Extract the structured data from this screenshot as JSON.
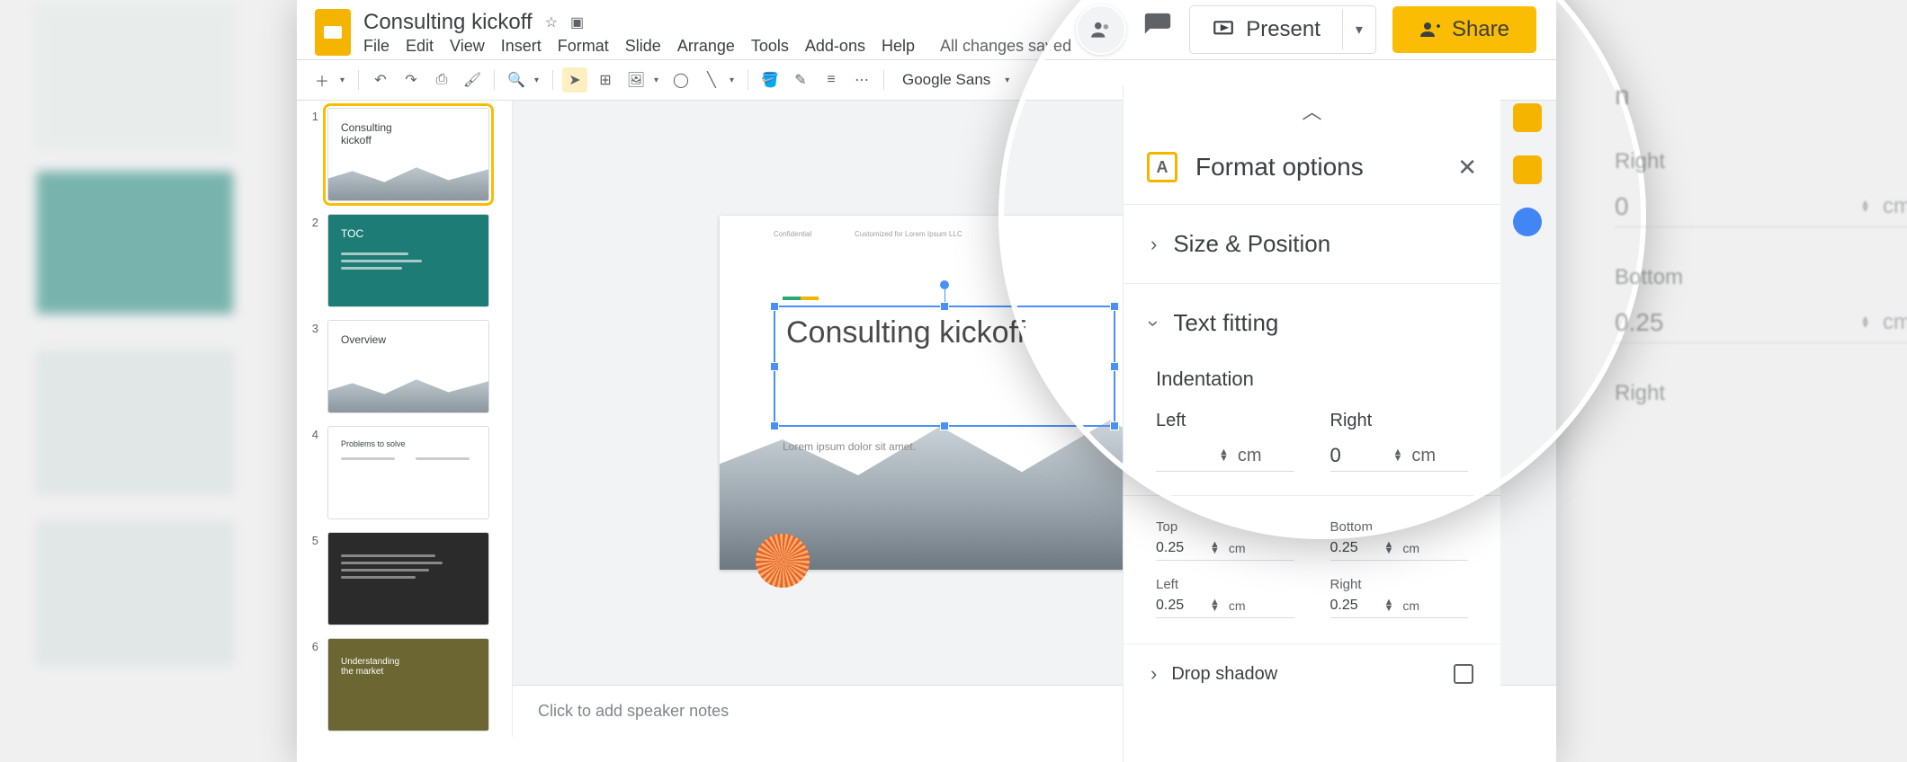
{
  "doc_title": "Consulting kickoff",
  "menus": [
    "File",
    "Edit",
    "View",
    "Insert",
    "Format",
    "Slide",
    "Arrange",
    "Tools",
    "Add-ons",
    "Help"
  ],
  "save_status": "All changes saved",
  "present_label": "Present",
  "share_label": "Share",
  "font_name": "Google Sans",
  "thumbs": [
    {
      "n": "1",
      "title": "Consulting\nkickoff"
    },
    {
      "n": "2",
      "title": "TOC"
    },
    {
      "n": "3",
      "title": "Overview"
    },
    {
      "n": "4",
      "title": "Problems to solve"
    },
    {
      "n": "5",
      "title": ""
    },
    {
      "n": "6",
      "title": "Understanding\nthe market"
    }
  ],
  "canvas": {
    "confidential": "Confidential",
    "customized": "Customized for Lorem Ipsum LLC",
    "title": "Consulting kickoff",
    "subtitle": "Lorem ipsum dolor sit amet."
  },
  "notes_placeholder": "Click to add speaker notes",
  "format_panel": {
    "title": "Format options",
    "size_pos": "Size & Position",
    "text_fitting": "Text fitting",
    "indentation": "Indentation",
    "left": "Left",
    "right": "Right",
    "right_val": "0",
    "unit": "cm",
    "top": "Top",
    "bottom": "Bottom",
    "top_val": "0.25",
    "bottom_val": "0.25",
    "left2_val": "0.25",
    "right2_val": "0.25",
    "drop_shadow": "Drop shadow"
  },
  "faded": {
    "right_label": "Right",
    "right_val": "0",
    "bottom_label": "Bottom",
    "bottom_val": "0.25",
    "right2_label": "Right",
    "unit": "cm"
  }
}
